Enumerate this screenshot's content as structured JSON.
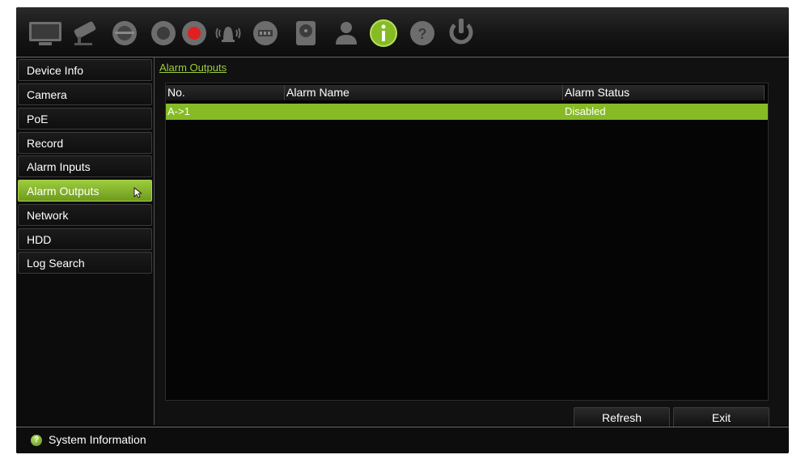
{
  "toolbar": {
    "icons": [
      "monitor-icon",
      "camera-icon",
      "ptz-dome-icon",
      "record-icon",
      "alarm-icon",
      "network-icon",
      "hdd-icon",
      "user-icon",
      "info-icon",
      "help-icon",
      "power-icon"
    ],
    "active_icon": "info-icon"
  },
  "sidebar": {
    "items": [
      {
        "label": "Device Info"
      },
      {
        "label": "Camera"
      },
      {
        "label": "PoE"
      },
      {
        "label": "Record"
      },
      {
        "label": "Alarm Inputs"
      },
      {
        "label": "Alarm Outputs"
      },
      {
        "label": "Network"
      },
      {
        "label": "HDD"
      },
      {
        "label": "Log Search"
      }
    ],
    "active": "Alarm Outputs"
  },
  "main": {
    "title": "Alarm Outputs",
    "table": {
      "columns": [
        "No.",
        "Alarm Name",
        "Alarm Status"
      ],
      "rows": [
        {
          "no": "A->1",
          "name": "",
          "status": "Disabled",
          "selected": true
        }
      ]
    },
    "buttons": {
      "refresh": "Refresh",
      "exit": "Exit"
    }
  },
  "status_bar": {
    "label": "System Information"
  },
  "colors": {
    "accent": "#86bb25",
    "background": "#0a0a0a",
    "text": "#ffffff"
  }
}
